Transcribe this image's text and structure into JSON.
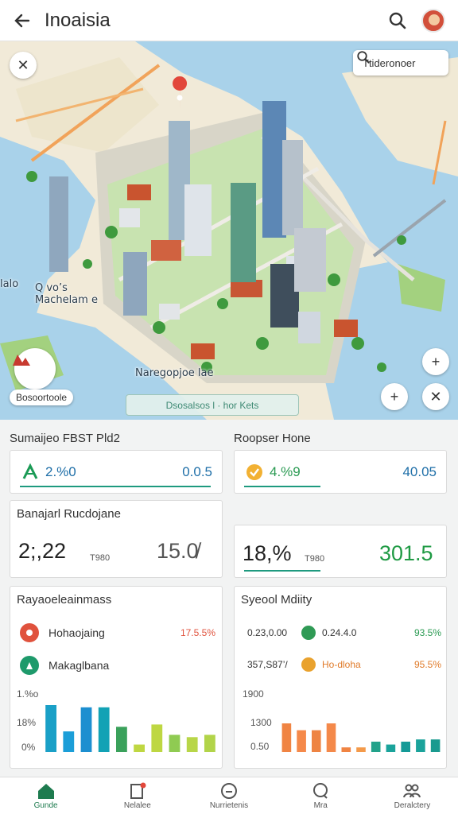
{
  "header": {
    "title": "Inoaisia"
  },
  "map": {
    "search_placeholder": "Ttideronoer",
    "labels": {
      "left": "Q vo’s\nMachelam e",
      "center": "Naregopjoe lae",
      "left_edge": "lalo"
    },
    "location_name": "Bosoortoole",
    "banner": "Dsosalsos l · hor Kets"
  },
  "section_left": {
    "title": "Sumaijeo FBST Pld2",
    "kpi": {
      "a": "2.%0",
      "b": "0.0.5"
    },
    "big": {
      "title": "Banajarl Rucdojane",
      "a": "2;,22",
      "unit": "T980",
      "b": "15.0̸"
    },
    "legend_card": {
      "title": "Rayaoeleainmass",
      "rows": [
        {
          "label": "Hohaojaing",
          "value": "17.5.5%"
        },
        {
          "label": "Makaglbana",
          "value": ""
        }
      ],
      "axis": [
        "1.%o",
        "18%",
        "0%"
      ]
    }
  },
  "section_right": {
    "title": "Roopser Hone",
    "kpi": {
      "a": "4.%9",
      "b": "40.05"
    },
    "big": {
      "a": "18,%",
      "unit": "T980",
      "b": "301.5"
    },
    "legend_card": {
      "title": "Syeool Mdiity",
      "rows": [
        {
          "left": "0.23,0.00",
          "label": "0.24.4.0",
          "value": "93.5%"
        },
        {
          "left": "357,S87’/",
          "label": "Ho-dloha",
          "value": "95.5%"
        }
      ],
      "axis": [
        "1900",
        "1300",
        "0.50"
      ]
    }
  },
  "nav": {
    "items": [
      {
        "label": "Gunde",
        "icon": "home-icon"
      },
      {
        "label": "Nelalee",
        "icon": "document-icon"
      },
      {
        "label": "Nurrietenis",
        "icon": "compass-icon"
      },
      {
        "label": "Mra",
        "icon": "search-icon"
      },
      {
        "label": "Deralctery",
        "icon": "people-icon"
      }
    ]
  },
  "chart_data": [
    {
      "type": "bar",
      "categories": [
        "",
        "",
        "",
        "",
        "",
        "",
        "",
        "",
        "",
        ""
      ],
      "values": [
        0.82,
        0.36,
        0.78,
        0.78,
        0.44,
        0.13,
        0.48,
        0.3,
        0.26,
        0.3
      ],
      "colors": [
        "#1aa0c7",
        "#1b9ed8",
        "#1c8fd0",
        "#12a2b5",
        "#3aa15b",
        "#bfd742",
        "#bed742",
        "#8fcb52",
        "#b8d648",
        "#b2d449"
      ],
      "ytick_labels": [
        "1.%o",
        "18%",
        "0%"
      ],
      "ylim": [
        0,
        1
      ]
    },
    {
      "type": "bar",
      "categories": [
        "",
        "",
        "",
        "",
        "",
        "",
        "",
        "",
        "",
        "",
        ""
      ],
      "values": [
        0.5,
        0.38,
        0.38,
        0.5,
        0.08,
        0.08,
        0.18,
        0.13,
        0.18,
        0.22,
        0.22
      ],
      "colors": [
        "#f08443",
        "#f5894a",
        "#ee8443",
        "#f4894a",
        "#f08443",
        "#f49a4a",
        "#22a28a",
        "#1aa39b",
        "#149a97",
        "#1ba39b",
        "#1a9a8f"
      ],
      "ytick_labels": [
        "1900",
        "1300",
        "0.50"
      ],
      "ylim": [
        0,
        1
      ]
    }
  ]
}
